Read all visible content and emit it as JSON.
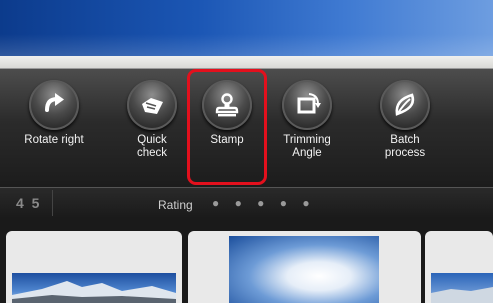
{
  "toolbar": {
    "items": [
      {
        "label": "Rotate right",
        "icon": "rotate-right-icon"
      },
      {
        "label": "Quick check",
        "icon": "quick-check-icon"
      },
      {
        "label": "Stamp",
        "icon": "stamp-icon"
      },
      {
        "label": "Trimming Angle",
        "icon": "trimming-angle-icon"
      },
      {
        "label": "Batch process",
        "icon": "batch-process-icon"
      }
    ],
    "highlighted": "Stamp",
    "highlight_color": "#e3101d"
  },
  "rating": {
    "stars_text": "4 5",
    "label": "Rating",
    "dots": "● ● ● ● ●"
  }
}
